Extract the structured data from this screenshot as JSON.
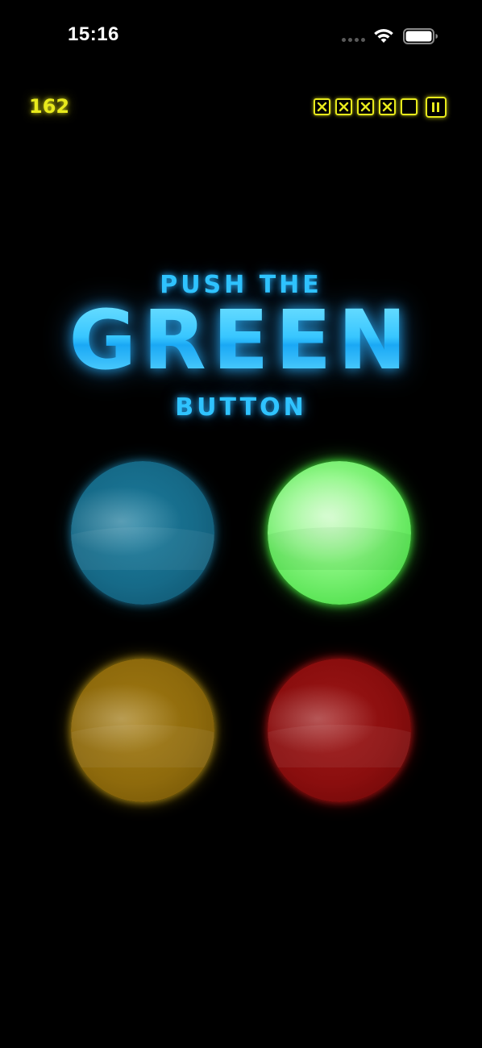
{
  "status_bar": {
    "time": "15:16",
    "signal_icon": "cellular-signal-icon",
    "wifi_icon": "wifi-icon",
    "battery_icon": "battery-icon"
  },
  "hud": {
    "score": "162",
    "lives": [
      {
        "state": "crossed",
        "icon": "x-mark-icon"
      },
      {
        "state": "crossed",
        "icon": "x-mark-icon"
      },
      {
        "state": "crossed",
        "icon": "x-mark-icon"
      },
      {
        "state": "crossed",
        "icon": "x-mark-icon"
      },
      {
        "state": "empty",
        "icon": ""
      }
    ],
    "pause_icon": "pause-icon",
    "accent_color": "#e8ea1c"
  },
  "instruction": {
    "line1": "PUSH THE",
    "color_word": "GREEN",
    "line3": "BUTTON",
    "color": "#2fc3ff"
  },
  "buttons": [
    {
      "name": "blue",
      "color": "#166a88",
      "active": false
    },
    {
      "name": "green",
      "color": "#7ef275",
      "active": true
    },
    {
      "name": "yellow",
      "color": "#8e6a0c",
      "active": false
    },
    {
      "name": "red",
      "color": "#8a0e0e",
      "active": false
    }
  ]
}
